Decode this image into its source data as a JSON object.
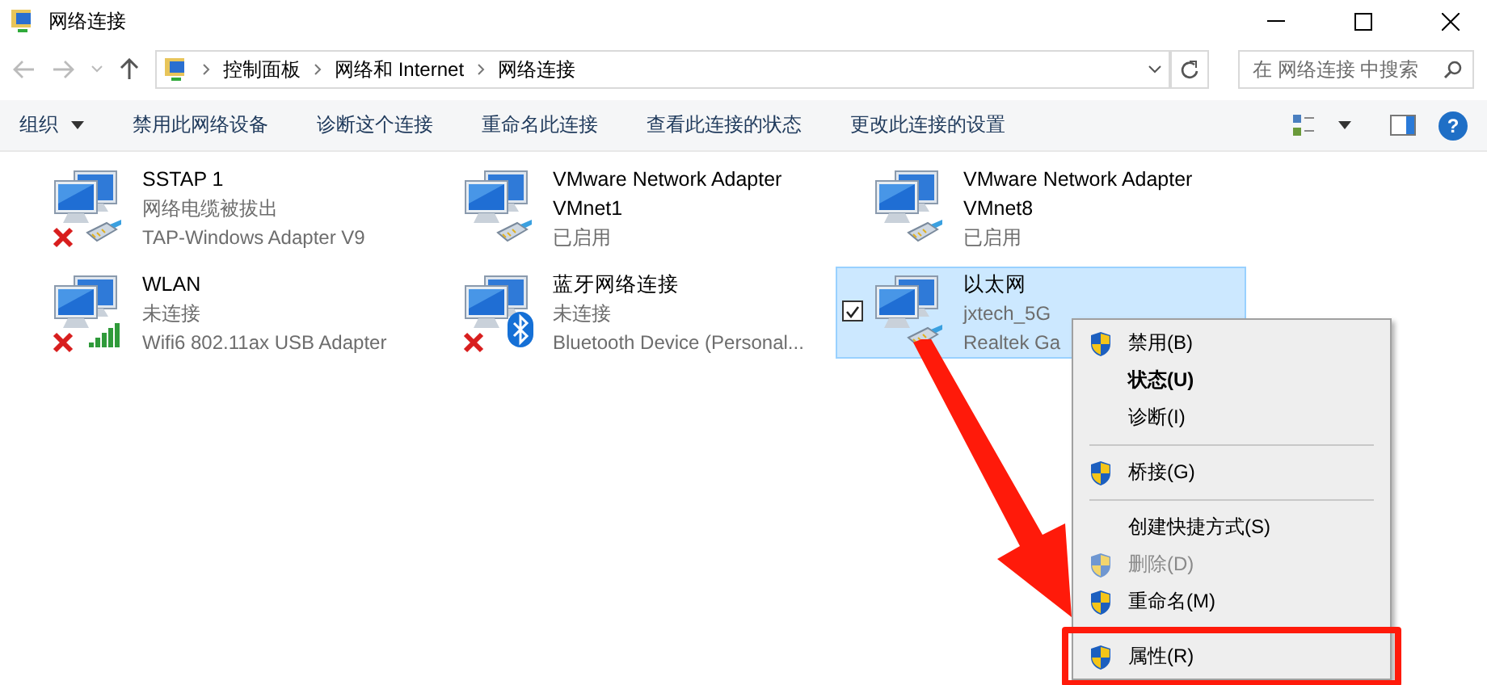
{
  "window": {
    "title": "网络连接"
  },
  "address": {
    "crumbs": [
      "控制面板",
      "网络和 Internet",
      "网络连接"
    ]
  },
  "search": {
    "placeholder": "在 网络连接 中搜索"
  },
  "commands": [
    {
      "label": "组织",
      "dropdown": true
    },
    {
      "label": "禁用此网络设备",
      "dropdown": false
    },
    {
      "label": "诊断这个连接",
      "dropdown": false
    },
    {
      "label": "重命名此连接",
      "dropdown": false
    },
    {
      "label": "查看此连接的状态",
      "dropdown": false
    },
    {
      "label": "更改此连接的设置",
      "dropdown": false
    }
  ],
  "help": {
    "label": "?"
  },
  "adapters": [
    {
      "name": "SSTAP 1",
      "status": "网络电缆被拔出",
      "device": "TAP-Windows Adapter V9",
      "kind": "cable",
      "disconnected": true,
      "selected": false
    },
    {
      "name": "VMware Network Adapter VMnet1",
      "status": "已启用",
      "kind": "cable",
      "disconnected": false,
      "selected": false
    },
    {
      "name": "VMware Network Adapter VMnet8",
      "status": "已启用",
      "kind": "cable",
      "disconnected": false,
      "selected": false
    },
    {
      "name": "WLAN",
      "status": "未连接",
      "device": "Wifi6 802.11ax USB Adapter",
      "kind": "wifi",
      "disconnected": true,
      "selected": false
    },
    {
      "name": "蓝牙网络连接",
      "status": "未连接",
      "device": "Bluetooth Device (Personal...",
      "kind": "bluetooth",
      "disconnected": true,
      "selected": false
    },
    {
      "name": "以太网",
      "status": "jxtech_5G",
      "device": "Realtek Ga",
      "kind": "cable",
      "disconnected": false,
      "selected": true,
      "checked": true
    }
  ],
  "context_menu": [
    {
      "kind": "item",
      "label": "禁用(B)",
      "shield": true,
      "bold": false,
      "disabled": false,
      "highlighted": false
    },
    {
      "kind": "item",
      "label": "状态(U)",
      "shield": false,
      "bold": true,
      "disabled": false,
      "highlighted": false
    },
    {
      "kind": "item",
      "label": "诊断(I)",
      "shield": false,
      "bold": false,
      "disabled": false,
      "highlighted": false
    },
    {
      "kind": "separator"
    },
    {
      "kind": "item",
      "label": "桥接(G)",
      "shield": true,
      "bold": false,
      "disabled": false,
      "highlighted": false
    },
    {
      "kind": "separator"
    },
    {
      "kind": "item",
      "label": "创建快捷方式(S)",
      "shield": false,
      "bold": false,
      "disabled": false,
      "highlighted": false
    },
    {
      "kind": "item",
      "label": "删除(D)",
      "shield": true,
      "bold": false,
      "disabled": true,
      "highlighted": false
    },
    {
      "kind": "item",
      "label": "重命名(M)",
      "shield": true,
      "bold": false,
      "disabled": false,
      "highlighted": false
    },
    {
      "kind": "item",
      "label": "属性(R)",
      "shield": true,
      "bold": false,
      "disabled": false,
      "highlighted": true
    }
  ]
}
